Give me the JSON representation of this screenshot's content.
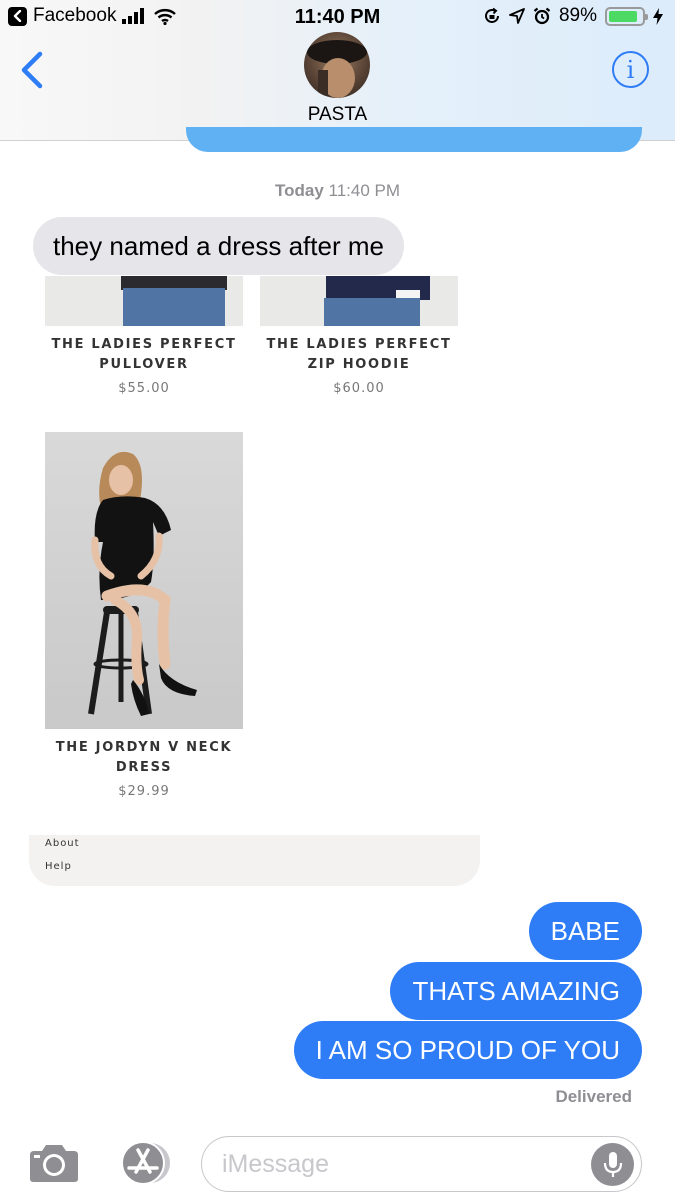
{
  "status_bar": {
    "back_app": "Facebook",
    "time": "11:40 PM",
    "battery_percent": "89%",
    "battery_level": 0.89,
    "battery_color": "#4cd964"
  },
  "header": {
    "contact_name": "PASTA",
    "info_label": "i"
  },
  "conversation": {
    "timestamp_day": "Today",
    "timestamp_time": "11:40 PM",
    "incoming_message": "they named a dress after me",
    "shared_image": {
      "products": [
        {
          "title_line1": "THE LADIES PERFECT",
          "title_line2": "PULLOVER",
          "price": "$55.00"
        },
        {
          "title_line1": "THE LADIES PERFECT",
          "title_line2": "ZIP HOODIE",
          "price": "$60.00"
        },
        {
          "title_line1": "THE JORDYN V NECK",
          "title_line2": "DRESS",
          "price": "$29.99"
        }
      ],
      "footer_links": [
        "About",
        "Help"
      ]
    },
    "outgoing_messages": [
      "BABE",
      "THATS AMAZING",
      "I AM SO PROUD OF YOU"
    ],
    "delivery_status": "Delivered"
  },
  "input_bar": {
    "placeholder": "iMessage"
  },
  "colors": {
    "outgoing_bubble": "#2f7df6",
    "incoming_bubble": "#e5e5ea",
    "accent": "#2f7df6"
  }
}
